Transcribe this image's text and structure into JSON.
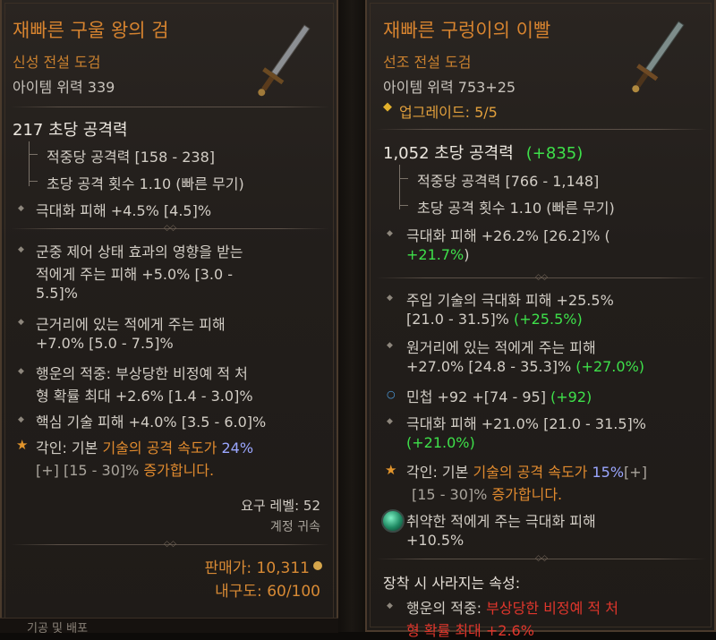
{
  "left": {
    "title": "재빠른 구울 왕의 검",
    "subtitle": "신성 전설 도검",
    "item_power": "아이템 위력 339",
    "dps": "217 초당 공격력",
    "hit_damage": "적중당 공격력 [158 - 238]",
    "attack_speed": "초당 공격 횟수 1.10 (빠른 무기)",
    "crit": "극대화 피해 +4.5% [4.5]%",
    "affixes": [
      [
        "군중 제어 상태 효과의 영향을 받는",
        "적에게 주는 피해 +5.0% [3.0 -",
        "5.5]%"
      ],
      [
        "근거리에 있는 적에게 주는 피해",
        "+7.0% [5.0 - 7.5]%"
      ],
      [
        "행운의 적중: 부상당한 비정예 적 처",
        "형 확률 최대 +2.6% [1.4 - 3.0]%"
      ],
      [
        "핵심 기술 피해 +4.0% [3.5 - 6.0]%"
      ]
    ],
    "aspect_line1_prefix": "각인: 기본 ",
    "aspect_line1_orange": "기술의 공격 속도가 ",
    "aspect_line1_blue": "24%",
    "aspect_line2_dim": "[+] [15 - 30]% ",
    "aspect_line2_orange": "증가합니다.",
    "req_level": "요구 레벨: 52",
    "account_bound": "계정 귀속",
    "sell": "판매가: 10,311",
    "durability": "내구도: 60/100",
    "bottom_cut": "기공 및 배포"
  },
  "right": {
    "title": "재빠른 구렁이의 이빨",
    "subtitle": "선조 전설 도검",
    "item_power": "아이템 위력 753+25",
    "upgrade": "업그레이드: 5/5",
    "dps": "1,052 초당 공격력",
    "dps_delta": "(+835)",
    "hit_damage": "적중당 공격력 [766 - 1,148]",
    "attack_speed": "초당 공격 횟수 1.10 (빠른 무기)",
    "crit_line1": "극대화 피해 +26.2% [26.2]% (",
    "crit_line2_green": "+21.7%",
    "crit_line2_end": ")",
    "affix1_l1": "주입 기술의 극대화 피해 +25.5%",
    "affix1_l2": "[21.0 - 31.5]% ",
    "affix1_l2_green": "(+25.5%)",
    "affix2_l1": "원거리에 있는 적에게 주는 피해",
    "affix2_l2": "+27.0% [24.8 - 35.3]% ",
    "affix2_l2_green": "(+27.0%)",
    "affix3": "민첩 +92 +[74 - 95] ",
    "affix3_green": "(+92)",
    "affix4_l1": "극대화 피해 +21.0% [21.0 - 31.5]%",
    "affix4_l2_green": "(+21.0%)",
    "aspect_line1_prefix": "각인: 기본 ",
    "aspect_line1_orange": "기술의 공격 속도가 ",
    "aspect_line1_blue": "15%",
    "aspect_line1_dim": "[+]",
    "aspect_line2_dim": "[15 - 30]% ",
    "aspect_line2_orange": "증가합니다.",
    "gem_l1": "취약한 적에게 주는 극대화 피해",
    "gem_l2": "+10.5%",
    "lost_header": "장착 시 사라지는 속성:",
    "lost_l1_prefix": "행운의 적중: ",
    "lost_l1_red": "부상당한 비정예 적 처",
    "lost_l2_red": "형 확률 최대 +2.6%"
  },
  "colors": {
    "title": "#d6832f",
    "green": "#3ee04a",
    "blue": "#9aa6ff",
    "red": "#e0362c"
  },
  "icons": [
    "sword-icon",
    "bullet-diamond-icon",
    "star-icon",
    "upgrade-diamond-icon",
    "gem-icon",
    "gold-coin-icon"
  ]
}
